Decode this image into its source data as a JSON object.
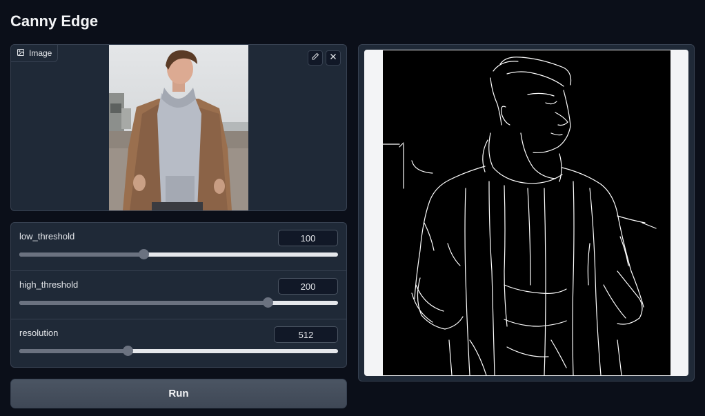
{
  "app": {
    "title": "Canny Edge"
  },
  "input_image": {
    "label": "Image",
    "label_icon": "image-icon",
    "edit_icon": "pencil-icon",
    "clear_icon": "close-icon"
  },
  "sliders": [
    {
      "label": "low_threshold",
      "value": "100",
      "fraction": 0.39
    },
    {
      "label": "high_threshold",
      "value": "200",
      "fraction": 0.78
    },
    {
      "label": "resolution",
      "value": "512",
      "fraction": 0.34
    }
  ],
  "run_button": {
    "label": "Run"
  },
  "colors": {
    "background": "#0b0f19",
    "panel": "#1f2937",
    "border": "#374151",
    "button": "#4b5563",
    "slider_thumb": "#6b7280"
  }
}
